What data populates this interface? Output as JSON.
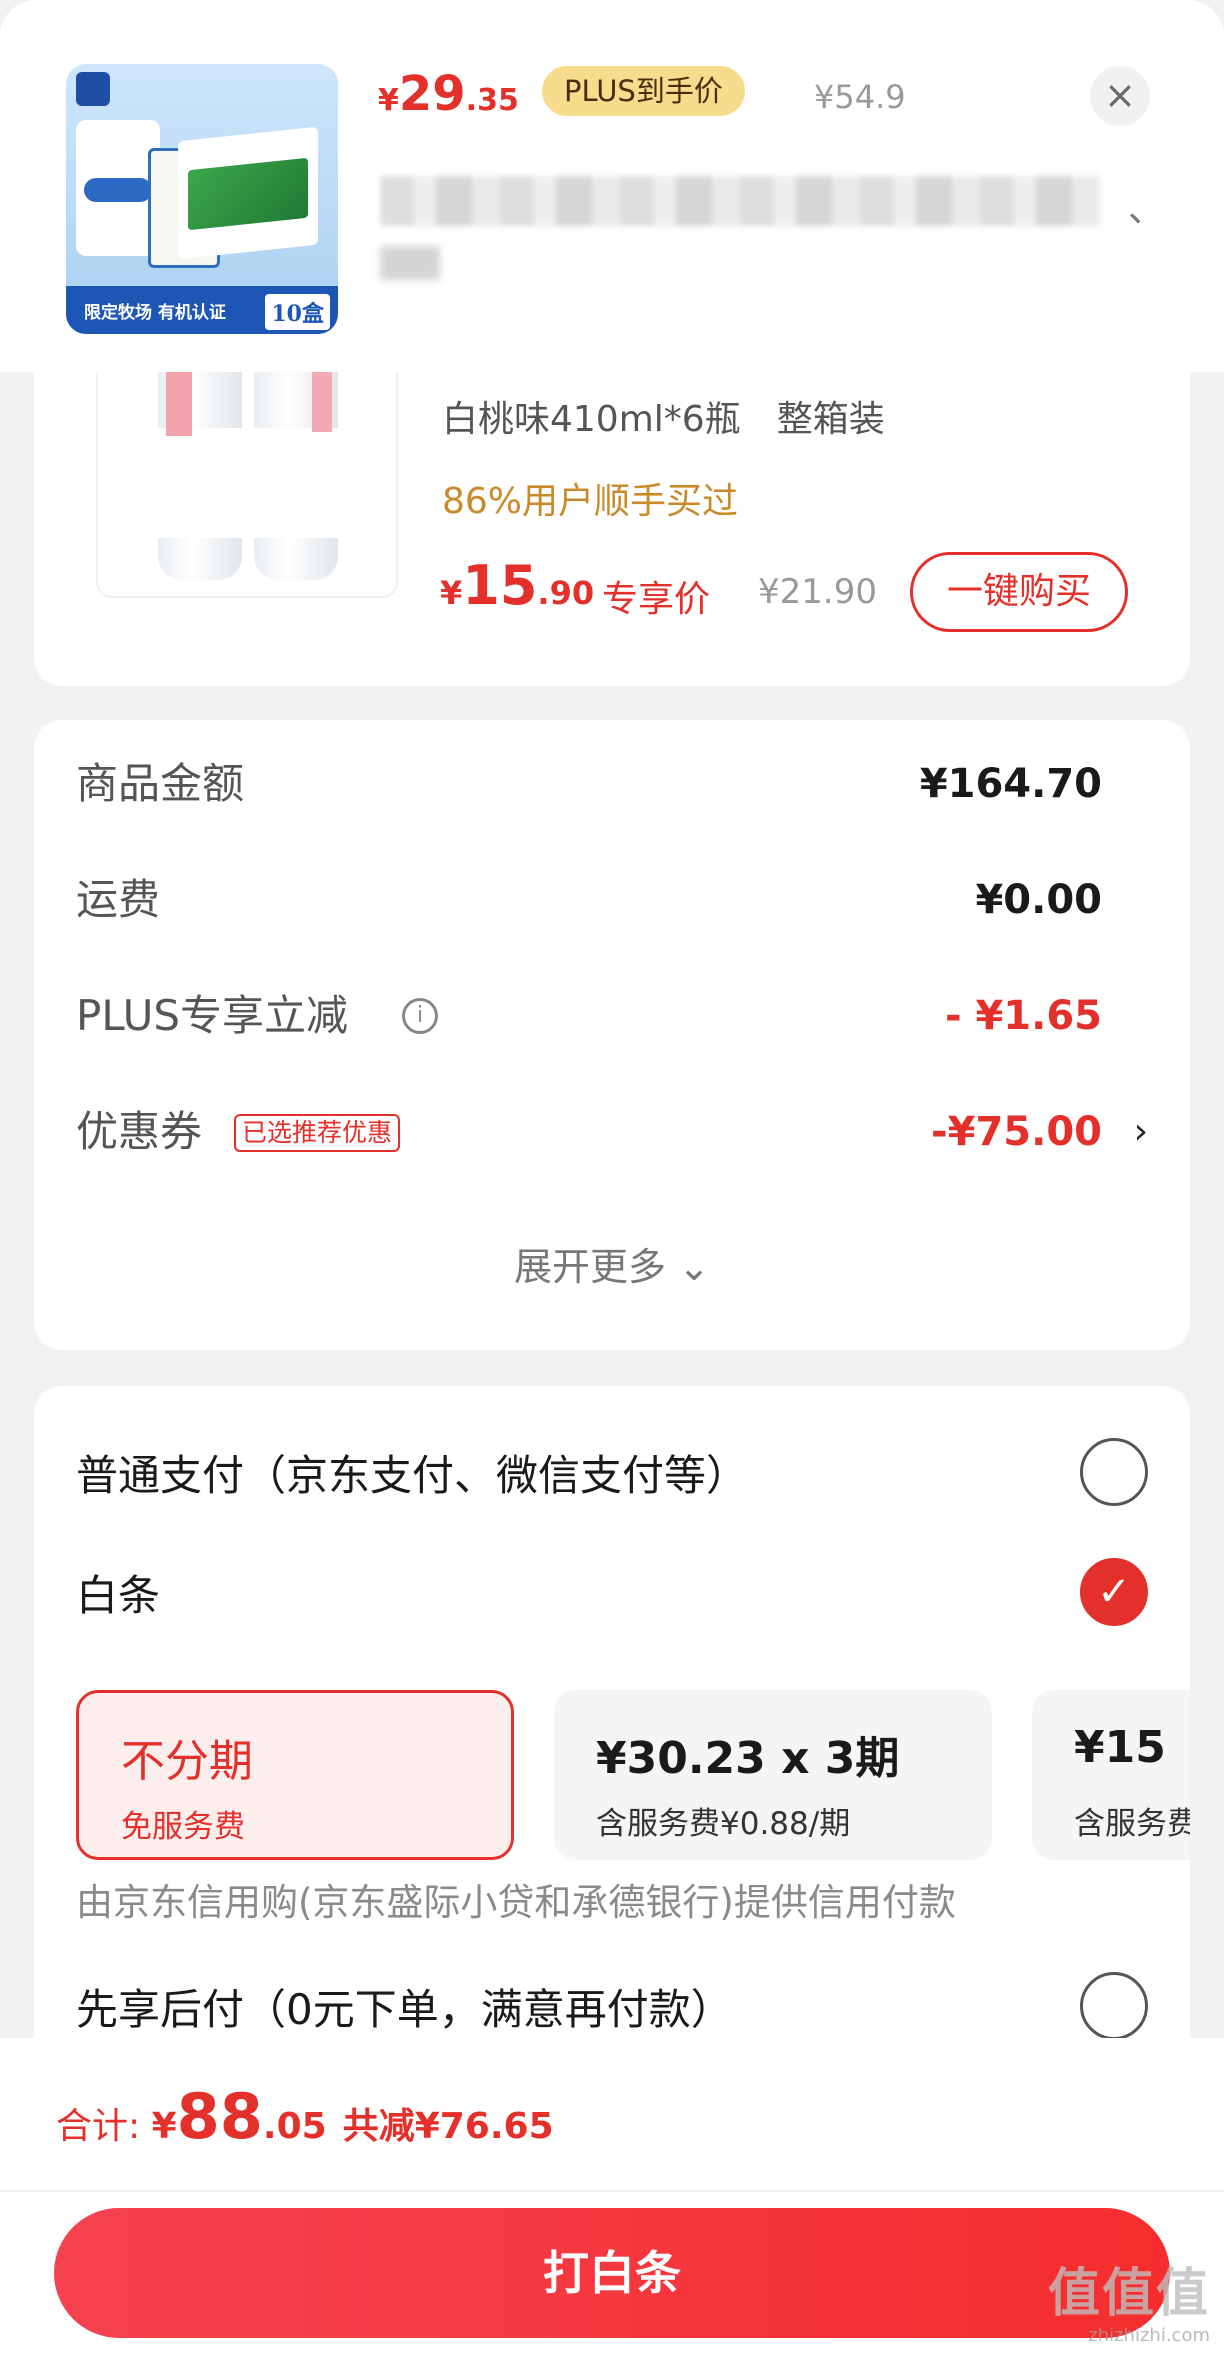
{
  "header": {
    "thumb_banner": "限定牧场 有机认证",
    "thumb_qty": "10盒",
    "price_symbol": "¥",
    "price_int": "29",
    "price_dec": ".35",
    "plus_badge": "PLUS到手价",
    "original_price": "¥54.9",
    "close_icon": "×",
    "chevron": "、"
  },
  "product": {
    "spec": "白桃味410ml*6瓶　整箱装",
    "sold_note": "86%用户顺手买过",
    "price_symbol": "¥",
    "price_int": "15",
    "price_dec": ".90",
    "exclusive_label": "专享价",
    "original_price": "¥21.90",
    "buy_button": "一键购买"
  },
  "summary": {
    "rows": [
      {
        "label": "商品金额",
        "value": "¥164.70"
      },
      {
        "label": "运费",
        "value": "¥0.00"
      },
      {
        "label": "PLUS专享立减",
        "value": "- ¥1.65",
        "info_icon": "i"
      },
      {
        "label": "优惠券",
        "tag": "已选推荐优惠",
        "value": "-¥75.00",
        "chevron": "›"
      }
    ],
    "expand": "展开更多 ⌄"
  },
  "payment": {
    "normal": "普通支付（京东支付、微信支付等）",
    "baitiao": "白条",
    "check": "✓",
    "plans": [
      {
        "title": "不分期",
        "sub": "免服务费"
      },
      {
        "title": "¥30.23 x 3期",
        "sub": "含服务费¥0.88/期"
      },
      {
        "title": "¥15",
        "sub": "含服务费"
      }
    ],
    "credit_note": "由京东信用购(京东盛际小贷和承德银行)提供信用付款",
    "pay_later": "先享后付（0元下单，满意再付款）"
  },
  "footer": {
    "total_label": "合计: ",
    "total_symbol": "¥",
    "total_int": "88",
    "total_dec": ".05",
    "saved": "共减¥76.65",
    "pay_button": "打白条"
  },
  "watermark": {
    "big": "值值值",
    "small": "zhizhizhi.com"
  },
  "colors": {
    "accent": "#e4302b",
    "plus_badge_bg": "#f7dc8d",
    "sold_note": "#c98a2a"
  }
}
